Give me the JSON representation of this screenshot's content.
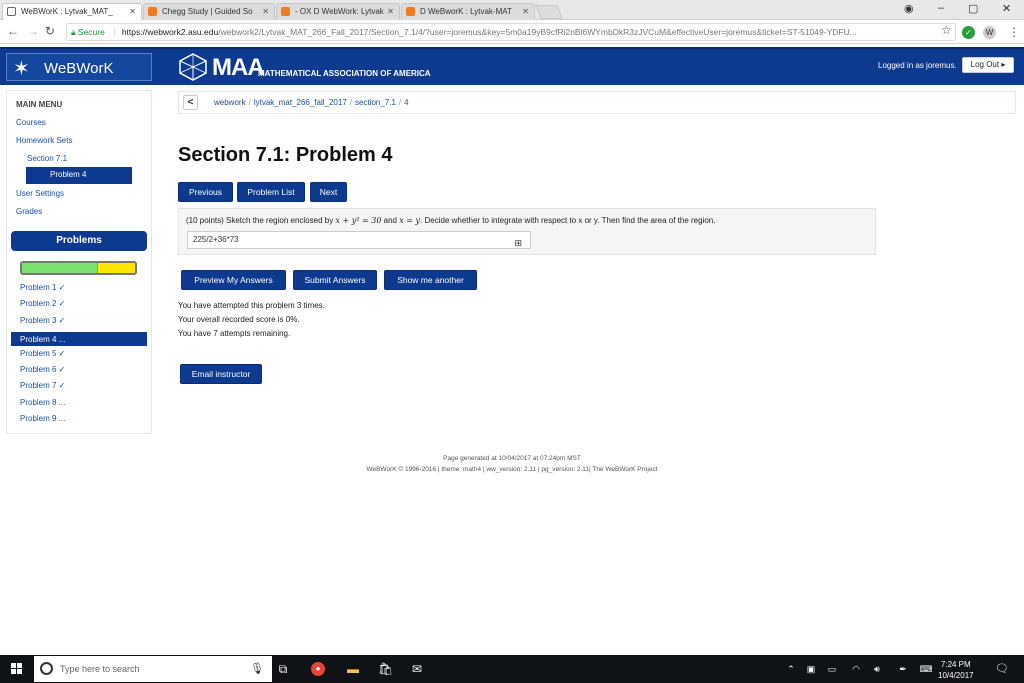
{
  "browser": {
    "tabs": [
      {
        "label": "WeBWorK : Lytvak_MAT_",
        "icon": "doc-icon"
      },
      {
        "label": "Chegg Study | Guided So",
        "icon": "chegg-icon"
      },
      {
        "label": "- OX D WebWork: Lytvak",
        "icon": "chegg-icon"
      },
      {
        "label": "D WeBworK : Lytvak-MAT",
        "icon": "chegg-icon"
      }
    ],
    "address": {
      "secure_label": "Secure",
      "host": "https://webwork2.asu.edu",
      "path": "/webwork2/Lytvak_MAT_266_Fall_2017/Section_7.1/4/?user=joremus&key=5m0a19yB9cfRi2nBl6WYmbDkR3zJVCuM&effectiveUser=joremus&ticket=ST-51049-YDFU..."
    }
  },
  "header": {
    "brand": "WeBWorK",
    "maa_big": "MAA",
    "maa_small": "MATHEMATICAL ASSOCIATION OF AMERICA",
    "logged_in": "Logged in as joremus.",
    "logout_label": "Log Out ▸"
  },
  "sidebar": {
    "menu_title": "MAIN MENU",
    "courses": "Courses",
    "homework_sets": "Homework Sets",
    "section": "Section 7.1",
    "problem": "Problem 4",
    "user_settings": "User Settings",
    "grades": "Grades",
    "problems_title": "Problems",
    "progress": {
      "correct_fraction": 0.67,
      "partial_fraction": 0.33
    },
    "problem_list": [
      "Problem 1 ✓",
      "Problem 2 ✓",
      "Problem 3 ✓",
      "Problem 4 ...",
      "Problem 5 ✓",
      "Problem 6 ✓",
      "Problem 7 ✓",
      "Problem 8 ...",
      "Problem 9 ..."
    ],
    "active_problem_index": 3
  },
  "breadcrumb": {
    "back": "<",
    "items": [
      "webwork",
      "lytvak_mat_266_fall_2017",
      "section_7.1",
      "4"
    ]
  },
  "main": {
    "title": "Section 7.1: Problem 4",
    "nav_buttons": {
      "previous": "Previous",
      "list": "Problem List",
      "next": "Next"
    },
    "problem_text_pre": "(10 points) Sketch the region enclosed by ",
    "eq1": "x + y² = 30",
    "and": " and ",
    "eq2": "x = y",
    "problem_text_post": ". Decide whether to integrate with respect to x or y. Then find the area of the region.",
    "answer_value": "225/2+36*73",
    "buttons": {
      "preview": "Preview My Answers",
      "submit": "Submit Answers",
      "another": "Show me another"
    },
    "attempts_text": "You have attempted this problem 3 times.",
    "score_text": "Your overall recorded score is 0%.",
    "remaining_text": "You have 7 attempts remaining.",
    "email_label": "Email instructor"
  },
  "footer": {
    "generated": "Page generated at 10/04/2017 at 07:24pm MST",
    "copyright": "WeBWorK © 1996-2016 | theme: math4 | ww_version: 2.11 | pg_version: 2.11| The WeBWorK Project"
  },
  "taskbar": {
    "search_placeholder": "Type here to search",
    "time": "7:24 PM",
    "date": "10/4/2017"
  },
  "colors": {
    "brand": "#0d3a8f",
    "link": "#1a4fa0",
    "correct": "#7ae36f",
    "partial": "#ffe600"
  }
}
